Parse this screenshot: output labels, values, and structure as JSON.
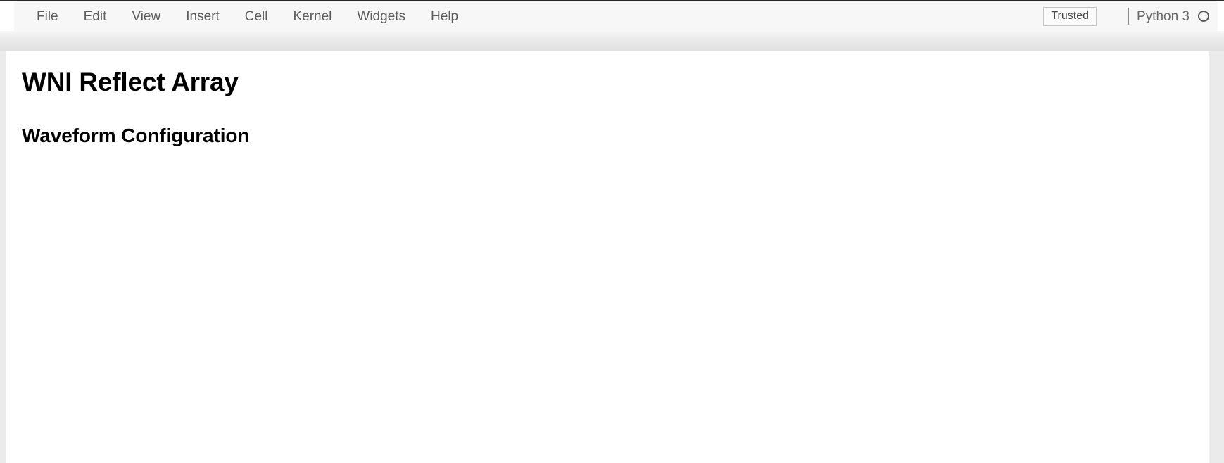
{
  "menubar": {
    "items": [
      {
        "label": "File"
      },
      {
        "label": "Edit"
      },
      {
        "label": "View"
      },
      {
        "label": "Insert"
      },
      {
        "label": "Cell"
      },
      {
        "label": "Kernel"
      },
      {
        "label": "Widgets"
      },
      {
        "label": "Help"
      }
    ],
    "trusted_label": "Trusted",
    "kernel_name": "Python 3",
    "kernel_indicator_icon": "circle-idle-icon"
  },
  "notebook": {
    "heading1": "WNI Reflect Array",
    "heading2": "Waveform Configuration"
  },
  "colors": {
    "menubar_bg": "#f7f7f7",
    "page_bg": "#ebebeb",
    "notebook_bg": "#ffffff",
    "menu_text": "#5c5c5c",
    "heading_text": "#000000",
    "badge_border": "#c6c6c6"
  }
}
